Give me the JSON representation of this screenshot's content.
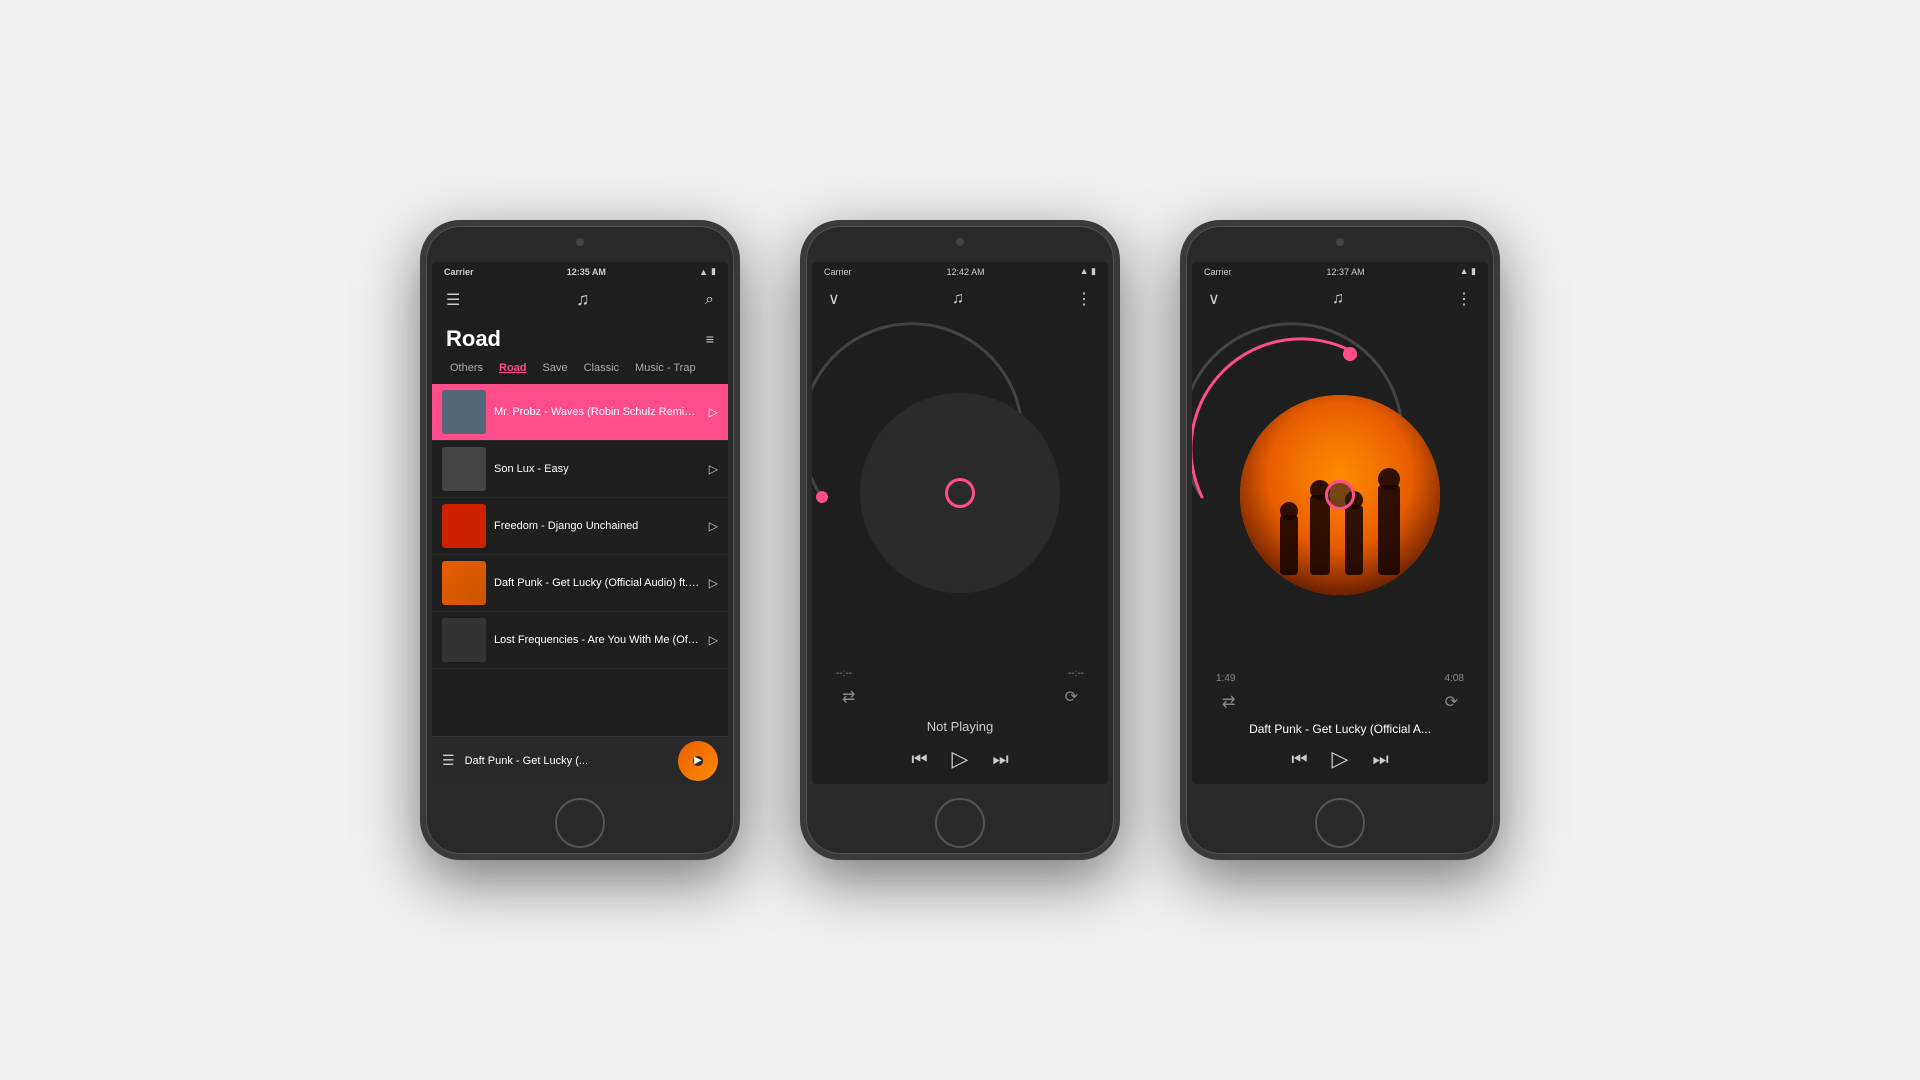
{
  "background_color": "#f0f0f0",
  "accent_color": "#ff4d8c",
  "phones": [
    {
      "id": "phone1",
      "screen": "playlist",
      "status_bar": {
        "carrier": "Carrier",
        "time": "12:35 AM",
        "wifi": true,
        "battery": true
      },
      "header": {
        "menu_icon": "☰",
        "music_note": "♫",
        "search_icon": "🔍"
      },
      "playlist_title": "Road",
      "sort_icon": "≡↓",
      "tabs": [
        "Others",
        "Road",
        "Save",
        "Classic",
        "Music - Trap"
      ],
      "active_tab": "Road",
      "songs": [
        {
          "title": "Mr. Probz - Waves (Robin Schulz Remix Radio Edit)",
          "thumb_color": "#555",
          "active": true
        },
        {
          "title": "Son Lux - Easy",
          "thumb_color": "#444",
          "active": false
        },
        {
          "title": "Freedom - Django Unchained",
          "thumb_color": "#cc2200",
          "active": false
        },
        {
          "title": "Daft Punk - Get Lucky (Official Audio) ft. Pharrell Wil",
          "thumb_color": "#cc5500",
          "active": false
        },
        {
          "title": "Lost Frequencies - Are You With Me (Official Music Video",
          "thumb_color": "#333",
          "active": false
        }
      ],
      "mini_player": {
        "title": "Daft Punk - Get Lucky (...",
        "thumb_gradient": "linear-gradient(135deg, #e85d00, #ff8c00)"
      }
    },
    {
      "id": "phone2",
      "screen": "player_empty",
      "status_bar": {
        "carrier": "Carrier",
        "time": "12:42 AM"
      },
      "player": {
        "time_left": "--:--",
        "time_right": "--:--",
        "status": "Not Playing",
        "progress_percent": 0,
        "song_title": ""
      }
    },
    {
      "id": "phone3",
      "screen": "player_playing",
      "status_bar": {
        "carrier": "Carrier",
        "time": "12:37 AM"
      },
      "player": {
        "time_left": "1:49",
        "time_right": "4:08",
        "status": "",
        "progress_percent": 44,
        "song_title": "Daft Punk - Get Lucky (Official A..."
      }
    }
  ]
}
